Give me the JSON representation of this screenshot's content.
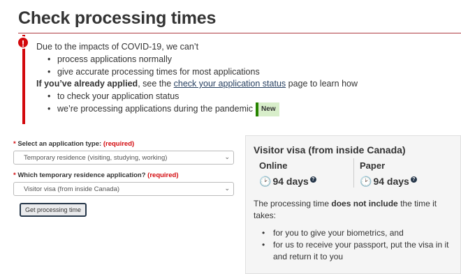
{
  "page": {
    "title": "Check processing times"
  },
  "alert": {
    "icon": "warning-icon",
    "intro": "Due to the impacts of COVID-19, we can’t",
    "bullets": [
      "process applications normally",
      "give accurate processing times for most applications"
    ],
    "applied_strong": "If you’ve already applied",
    "applied_pre": ", see the ",
    "applied_link": "check your application status",
    "applied_post": " page to learn how",
    "bullets2": [
      "to check your application status",
      "we’re processing applications during the pandemic"
    ],
    "badge_new": "New"
  },
  "form": {
    "field1": {
      "star": "*",
      "label": "Select an application type:",
      "required": "(required)",
      "value": "Temporary residence (visiting, studying, working)"
    },
    "field2": {
      "star": "*",
      "label": "Which temporary residence application?",
      "required": "(required)",
      "value": "Visitor visa (from inside Canada)"
    },
    "submit_label": "Get processing time"
  },
  "result": {
    "title": "Visitor visa (from inside Canada)",
    "online": {
      "label": "Online",
      "value": "94 days"
    },
    "paper": {
      "label": "Paper",
      "value": "94 days"
    },
    "note_pre": "The processing time ",
    "note_strong": "does not include",
    "note_post": " the time it takes:",
    "items": [
      "for you to give your biometrics, and",
      "for us to receive your passport, put the visa in it and return it to you"
    ]
  },
  "colors": {
    "accent_rule": "#af3c43",
    "alert_red": "#d3080c",
    "link": "#284162",
    "new_badge_bg": "#d8eeca",
    "new_badge_border": "#278400"
  }
}
